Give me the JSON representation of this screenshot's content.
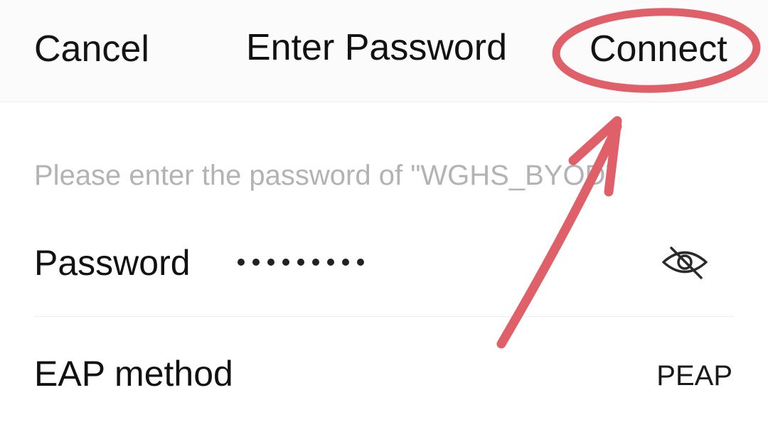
{
  "header": {
    "cancel_label": "Cancel",
    "title": "Enter Password",
    "connect_label": "Connect"
  },
  "hint": {
    "text": "Please enter the password of \"WGHS_BYOD\""
  },
  "password_row": {
    "label": "Password",
    "masked_length": 9,
    "toggle_icon": "eye-off-icon"
  },
  "eap_row": {
    "label": "EAP method",
    "value": "PEAP"
  },
  "annotation": {
    "color": "#e0606a",
    "shapes": [
      "circle-around-connect",
      "arrow-pointing-to-connect"
    ]
  }
}
